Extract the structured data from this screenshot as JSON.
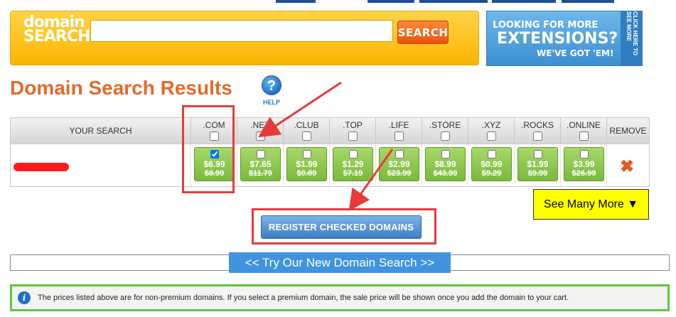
{
  "search": {
    "logo_line1": "domain",
    "logo_line2": "SEARCH",
    "input_value": "",
    "button_label": "SEARCH"
  },
  "ad": {
    "line1": "LOOKING FOR MORE",
    "line2": "EXTENSIONS?",
    "line3": "WE'VE GOT 'EM!",
    "side": "CLICK HERE TO SEE MORE"
  },
  "page": {
    "title": "Domain Search Results",
    "help_label": "HELP"
  },
  "table": {
    "your_search_label": "YOUR SEARCH",
    "remove_label": "REMOVE",
    "extensions": [
      {
        "ext": ".COM",
        "price": "$6.99",
        "original": "$8.99",
        "checked": true
      },
      {
        "ext": ".NET",
        "price": "$7.65",
        "original": "$11.79",
        "checked": false
      },
      {
        "ext": ".CLUB",
        "price": "$1.99",
        "original": "$9.89",
        "checked": false
      },
      {
        "ext": ".TOP",
        "price": "$1.29",
        "original": "$7.19",
        "checked": false
      },
      {
        "ext": ".LIFE",
        "price": "$2.99",
        "original": "$23.99",
        "checked": false
      },
      {
        "ext": ".STORE",
        "price": "$8.99",
        "original": "$43.99",
        "checked": false
      },
      {
        "ext": ".XYZ",
        "price": "$0.99",
        "original": "$9.29",
        "checked": false
      },
      {
        "ext": ".ROCKS",
        "price": "$1.99",
        "original": "$9.99",
        "checked": false
      },
      {
        "ext": ".ONLINE",
        "price": "$3.99",
        "original": "$26.99",
        "checked": false
      }
    ],
    "remove_icon": "x-icon"
  },
  "actions": {
    "see_more": "See Many More ▼",
    "register": "REGISTER CHECKED DOMAINS",
    "new_search": "<< Try Our New Domain Search >>"
  },
  "info": {
    "text": "The prices listed above are for non-premium domains. If you select a premium domain, the sale price will be shown once you add the domain to your cart."
  },
  "colors": {
    "title": "#e36a2a",
    "price_green": "#78b93a",
    "annotation_red": "#e83a3a",
    "annotation_green": "#5cc83a"
  }
}
